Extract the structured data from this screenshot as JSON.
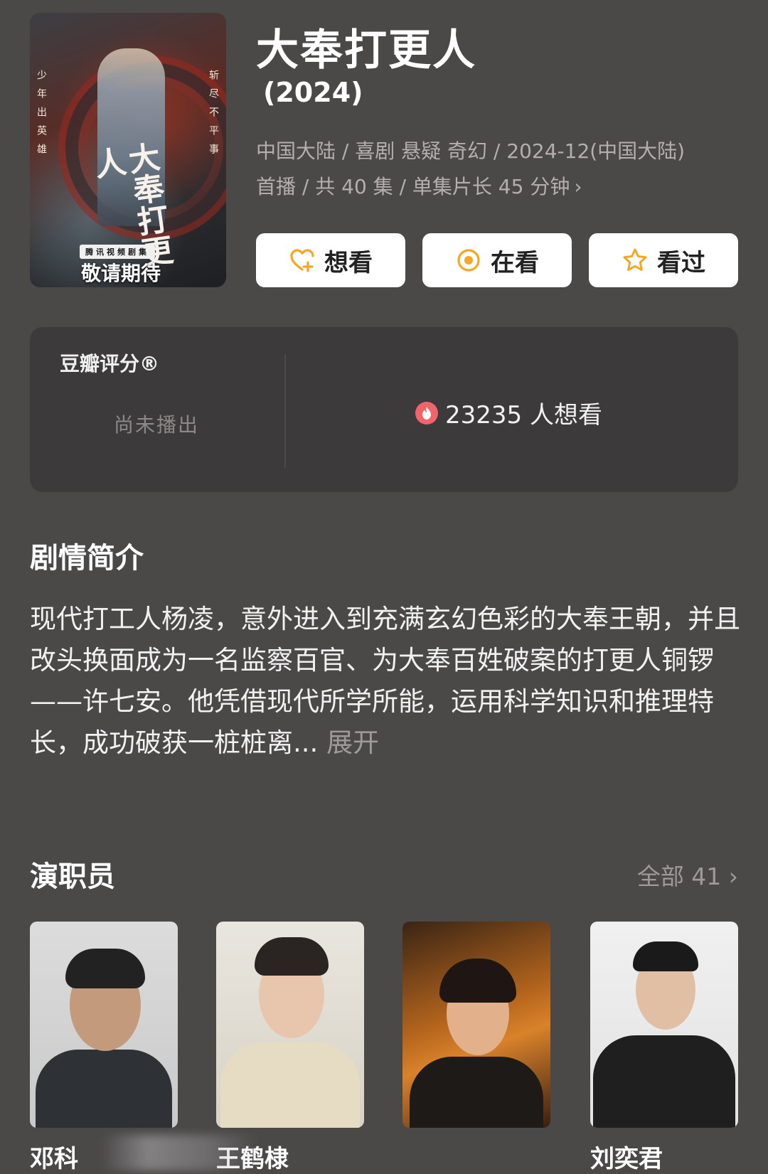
{
  "header": {
    "title": "大奉打更人",
    "year": "(2024)",
    "meta_line1": "中国大陆 / 喜剧 悬疑 奇幻 / 2024-12(中国大陆)",
    "meta_line2": "首播 / 共 40 集 / 单集片长 45 分钟",
    "chevron": "›"
  },
  "poster": {
    "left_text": "少年出英雄",
    "right_text": "斩尽不平事",
    "calligraphy": "大奉打更人",
    "seal": "腾讯视频剧集",
    "coming": "敬请期待"
  },
  "actions": {
    "want": "想看",
    "watching": "在看",
    "watched": "看过"
  },
  "rating": {
    "label": "豆瓣评分®",
    "status": "尚未播出",
    "want_count": "23235 人想看"
  },
  "synopsis": {
    "title": "剧情简介",
    "text": "现代打工人杨凌，意外进入到充满玄幻色彩的大奉王朝，并且改头换面成为一名监察百官、为大奉百姓破案的打更人铜锣——许七安。他凭借现代所学所能，运用科学知识和推理特长，成功破获一桩桩离...",
    "expand": "展开"
  },
  "cast": {
    "title": "演职员",
    "all_label": "全部 41",
    "chevron": "›",
    "members": [
      {
        "name": "邓科"
      },
      {
        "name": "王鹤棣"
      },
      {
        "name": ""
      },
      {
        "name": "刘奕君"
      }
    ]
  },
  "colors": {
    "background": "#4b4848",
    "card": "#3c3a3a",
    "accent_orange": "#f5a623",
    "fire_red": "#f2636a"
  }
}
